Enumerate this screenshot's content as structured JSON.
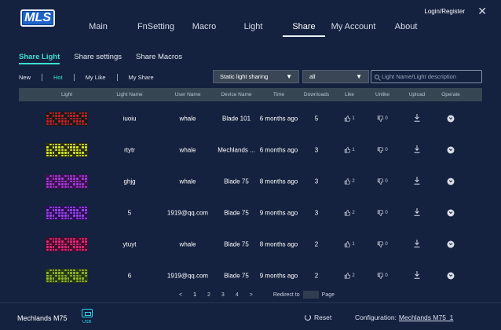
{
  "app": {
    "logo_text": "MLS",
    "login_label": "Login/Register",
    "close_glyph": "✕"
  },
  "nav": {
    "tabs": [
      {
        "label": "Main",
        "active": false
      },
      {
        "label": "FnSetting",
        "active": false
      },
      {
        "label": "Macro",
        "active": false
      },
      {
        "label": "Light",
        "active": false
      },
      {
        "label": "Share",
        "active": true
      },
      {
        "label": "My Account",
        "active": false
      },
      {
        "label": "About",
        "active": false
      }
    ]
  },
  "subtabs": [
    {
      "label": "Share Light",
      "active": true
    },
    {
      "label": "Share settings",
      "active": false
    },
    {
      "label": "Share Macros",
      "active": false
    }
  ],
  "filters": [
    {
      "label": "New",
      "active": false
    },
    {
      "label": "Hot",
      "active": true
    },
    {
      "label": "My Like",
      "active": false
    },
    {
      "label": "My Share",
      "active": false
    }
  ],
  "type_select": {
    "value": "Static light sharing",
    "arrow": "▼"
  },
  "device_select": {
    "value": "all",
    "arrow": "▼"
  },
  "search": {
    "placeholder": "Light Name/Light description"
  },
  "table": {
    "columns": [
      "Light",
      "Light Name",
      "User Name",
      "Device Name",
      "Time",
      "Downloads",
      "Like",
      "Unlike",
      "Upload",
      "Operate"
    ],
    "rows": [
      {
        "preview": "red",
        "light_name": "iuoiu",
        "user_name": "whale",
        "device": "Blade 101",
        "time": "6 months ago",
        "downloads": "5",
        "likes": "1",
        "unlikes": "0"
      },
      {
        "preview": "yellow",
        "light_name": "rtytr",
        "user_name": "whale",
        "device": "Mechlands ...",
        "time": "6 months ago",
        "downloads": "3",
        "likes": "1",
        "unlikes": "0"
      },
      {
        "preview": "purple",
        "light_name": "ghjg",
        "user_name": "whale",
        "device": "Blade 75",
        "time": "8 months ago",
        "downloads": "3",
        "likes": "2",
        "unlikes": "0"
      },
      {
        "preview": "violet",
        "light_name": "5",
        "user_name": "1919@qq.com",
        "device": "Blade 75",
        "time": "9 months ago",
        "downloads": "3",
        "likes": "2",
        "unlikes": "0"
      },
      {
        "preview": "pink",
        "light_name": "ytuyt",
        "user_name": "whale",
        "device": "Blade 75",
        "time": "8 months ago",
        "downloads": "2",
        "likes": "1",
        "unlikes": "0"
      },
      {
        "preview": "green",
        "light_name": "6",
        "user_name": "1919@qq.com",
        "device": "Blade 75",
        "time": "9 months ago",
        "downloads": "2",
        "likes": "2",
        "unlikes": "0"
      }
    ]
  },
  "pagination": {
    "prev": "<",
    "pages": [
      "1",
      "2",
      "3",
      "4"
    ],
    "current": "1",
    "next": ">",
    "redirect_label": "Redirect to",
    "page_label": "Page"
  },
  "footer": {
    "device_name": "Mechlands M75",
    "connection": "USB",
    "reset_label": "Reset",
    "config_label": "Configuration:",
    "config_value": "Mechlands M75_1"
  },
  "colors": {
    "background": "#14213f",
    "accent": "#3ee0d0",
    "header_bg": "#364753",
    "select_bg": "#3a4656",
    "usb": "#2fd3ee",
    "preview_palette": {
      "red": [
        "#c9202a",
        "#1b1b1b"
      ],
      "yellow": [
        "#d7e629",
        "#2b2e12"
      ],
      "purple": [
        "#a53ad8",
        "#3a1450"
      ],
      "violet": [
        "#9a45f0",
        "#2c1157"
      ],
      "pink": [
        "#e0287d",
        "#4a0d2b"
      ],
      "green": [
        "#8fb832",
        "#2a3a12"
      ]
    }
  }
}
